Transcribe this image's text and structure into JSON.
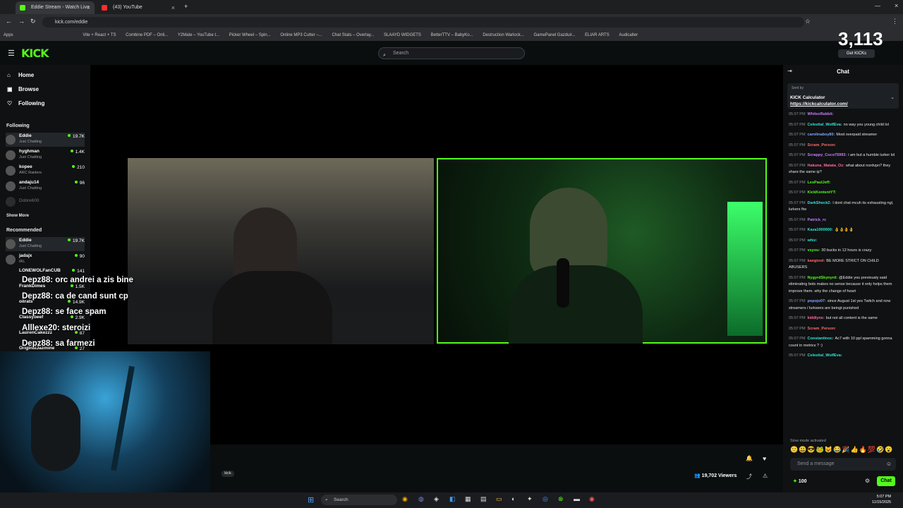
{
  "browser": {
    "tabs": [
      {
        "label": "Eddie Stream - Watch Live",
        "color": "#53fc18",
        "active": true
      },
      {
        "label": "(43) YouTube",
        "color": "#ff2d2d",
        "active": false
      }
    ],
    "url": "kick.com/eddie",
    "bookmarks": [
      "Apps",
      "Vite + React + TS",
      "Combine PDF – Onli...",
      "Y2Mate – YouTube t...",
      "Picker Wheel – Spin...",
      "Online MP3 Cutter –...",
      "Chat Stats – Overlay...",
      "SLAAYD WIDGETS",
      "BetterTTV – BabyKo...",
      "Destruction Warlock...",
      "GamePanel Gazduir...",
      "ELIAR ARTS",
      "Audicalter"
    ]
  },
  "header": {
    "logo": "KICK",
    "search_placeholder": "Search",
    "viewer_overlay": "3,113",
    "get_kicks": "Get KICKs"
  },
  "sidebar": {
    "nav": [
      "Home",
      "Browse",
      "Following"
    ],
    "following_title": "Following",
    "following": [
      {
        "name": "Eddie",
        "category": "Just Chatting",
        "viewers": "19.7K"
      },
      {
        "name": "hyghman",
        "category": "Just Chatting",
        "viewers": "1.4K"
      },
      {
        "name": "kopee",
        "category": "ARC Raiders",
        "viewers": "210"
      },
      {
        "name": "andaju14",
        "category": "Just Chatting",
        "viewers": "96"
      },
      {
        "name": "Dobre600",
        "category": "",
        "viewers": ""
      }
    ],
    "show_more": "Show More",
    "recommended_title": "Recommended",
    "recommended": [
      {
        "name": "Eddie",
        "category": "Just Chatting",
        "viewers": "19.7K"
      },
      {
        "name": "jadajx",
        "category": "IRL",
        "viewers": "90"
      },
      {
        "name": "LONEWOLFanCUB",
        "category": "",
        "viewers": "141"
      },
      {
        "name": "FrankDimes",
        "category": "",
        "viewers": "1.5K"
      },
      {
        "name": "oilrats",
        "category": "",
        "viewers": "14.9K"
      },
      {
        "name": "Classybeef",
        "category": "",
        "viewers": "2.9K"
      },
      {
        "name": "LaurenCakezzz",
        "category": "",
        "viewers": "87"
      },
      {
        "name": "OriginalJazmine",
        "category": "",
        "viewers": "27"
      }
    ]
  },
  "overlay_chat": [
    "Depz88: orc andrei a zis bine",
    "Depz88: ca de cand sunt cp",
    "Depz88: se face spam",
    "Alllexe20: steroizi",
    "Depz88: sa farmezi"
  ],
  "player": {
    "tag": "kick",
    "viewers": "19,702 Viewers"
  },
  "chat": {
    "title": "Chat",
    "pinned_sender": "Sent by",
    "pinned_title": "KICK Calculator",
    "pinned_link": "https://kickcalculator.com/",
    "messages": [
      {
        "time": "05:07 PM",
        "user": "WhitexRabbit:",
        "text": "",
        "color": "#c77dff"
      },
      {
        "time": "05:07 PM",
        "user": "Celestial_WolfEva:",
        "text": "no way you young child lol",
        "color": "#2ee6d6"
      },
      {
        "time": "05:07 PM",
        "user": "carolinaboy80:",
        "text": "Most overpaid streamer",
        "color": "#7aa7ff"
      },
      {
        "time": "05:07 PM",
        "user": "Scram_Person:",
        "text": "",
        "color": "#ff6b6b"
      },
      {
        "time": "05:07 PM",
        "user": "Scrappy_Coco75993:",
        "text": "i am but a humble lurker lol",
        "color": "#c77dff"
      },
      {
        "time": "05:07 PM",
        "user": "Hakuna_Matata_Oz:",
        "text": "what about nordvpn? they share the same ip?",
        "color": "#ff6b9e"
      },
      {
        "time": "05:07 PM",
        "user": "LesPaulJeff:",
        "text": "",
        "color": "#53fc18"
      },
      {
        "time": "05:07 PM",
        "user": "KickKontentYT:",
        "text": "",
        "color": "#53fc18"
      },
      {
        "time": "05:07 PM",
        "user": "DarkShock2:",
        "text": "I dont chat mcuh its exhausting ngl, lurkers ftw",
        "color": "#2ee6d6"
      },
      {
        "time": "05:07 PM",
        "user": "Patrick_rc",
        "text": "",
        "color": "#c77dff"
      },
      {
        "time": "05:07 PM",
        "user": "Kaza1000000:",
        "text": "👌👌👌👌",
        "color": "#2ee6d6"
      },
      {
        "time": "05:07 PM",
        "user": "whiz:",
        "text": "",
        "color": "#2ee6d6"
      },
      {
        "time": "05:07 PM",
        "user": "vsyou:",
        "text": "30 bucks in 12 hours is crazy",
        "color": "#53fc18"
      },
      {
        "time": "05:07 PM",
        "user": "kangtool:",
        "text": "BE MORE STRICT ON CHILD ABUSERS",
        "color": "#ff6b6b"
      },
      {
        "time": "05:07 PM",
        "user": "NygyrdSkynyrd:",
        "text": "@Eddie you previously said eliminating bots makes no sense because it only helps them improve them. why the change of heart",
        "color": "#53fc18"
      },
      {
        "time": "05:07 PM",
        "user": "popojo07:",
        "text": "since August 1st yes Twitch and now streamers / lurkwers are beingt punished",
        "color": "#7aa7ff"
      },
      {
        "time": "05:07 PM",
        "user": "kiddlynx:",
        "text": "but not all content is the same",
        "color": "#ff6b9e"
      },
      {
        "time": "05:07 PM",
        "user": "Scram_Person:",
        "text": "",
        "color": "#ff6b6b"
      },
      {
        "time": "05:07 PM",
        "user": "Constantinoc:",
        "text": "Ac7 with 10 ppl spamming gonna count in metrics ? :)",
        "color": "#2ee6d6"
      },
      {
        "time": "05:07 PM",
        "user": "Celestial_WolfEva:",
        "text": "",
        "color": "#2ee6d6"
      }
    ],
    "slow_mode": "Slow mode activated",
    "input_placeholder": "Send a message",
    "points": "100",
    "send_label": "Chat"
  },
  "taskbar": {
    "search": "Search",
    "time": "5:07 PM",
    "date": "11/15/2025"
  }
}
